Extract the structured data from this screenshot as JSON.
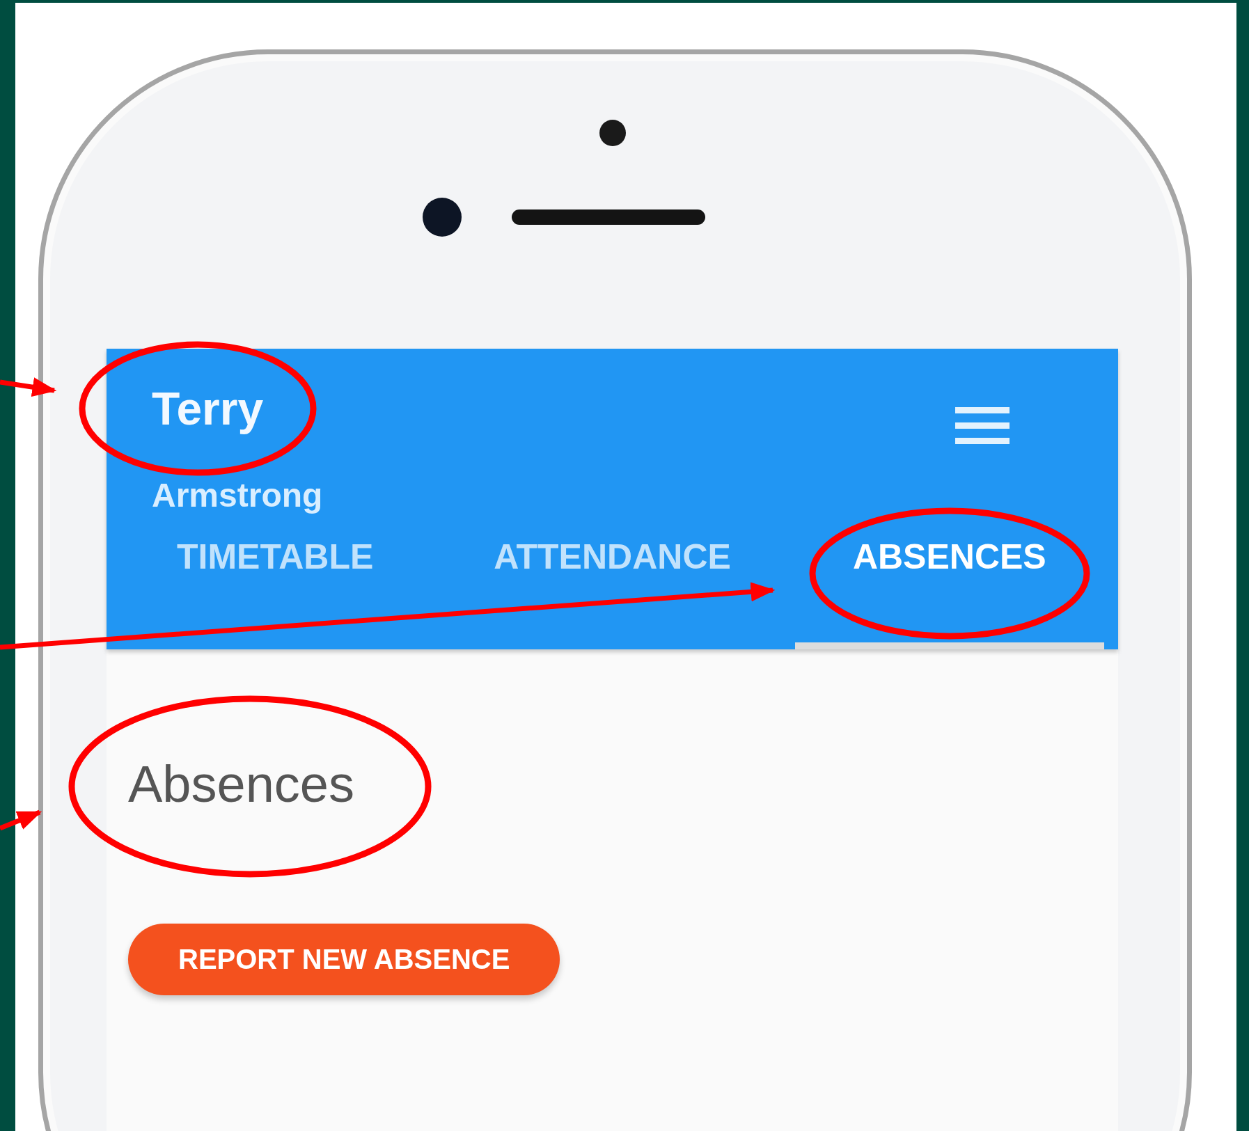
{
  "app_bar": {
    "title": "Terry",
    "subtitle": "Armstrong"
  },
  "tabs": [
    {
      "label": "TIMETABLE",
      "selected": false
    },
    {
      "label": "ATTENDANCE",
      "selected": false
    },
    {
      "label": "ABSENCES",
      "selected": true
    }
  ],
  "page": {
    "heading": "Absences",
    "button": "REPORT NEW ABSENCE"
  }
}
